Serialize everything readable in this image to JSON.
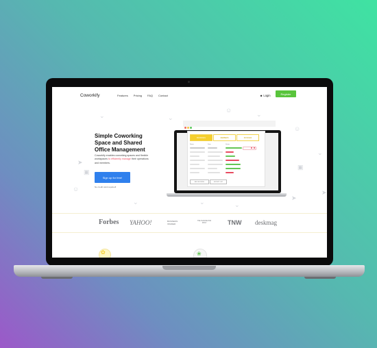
{
  "nav": {
    "logo": "Coworkify",
    "links": [
      "Features",
      "Pricing",
      "FAQ",
      "Contact"
    ],
    "login": "Login",
    "register": "Register"
  },
  "hero": {
    "title": "Simple Coworking Space and Shared Office Management",
    "desc_before": "Coworkify enables coworking spaces and flexible workspaces ",
    "desc_highlight": "to efficiently manage",
    "desc_after": " their operations and members.",
    "cta": "Sign up for free!",
    "note": "No credit card required!"
  },
  "app_preview": {
    "tabs": [
      "BOOKINGS",
      "MEMBERS",
      "INVOICES"
    ],
    "columns": [
      "Name",
      "Date",
      "Status"
    ],
    "buttons": [
      "ADD BOOKING",
      "EXPORT LIST"
    ]
  },
  "logos": [
    "Forbes",
    "YAHOO!",
    "BUSINESS INSIDER",
    "THE HUFFINGTON POST",
    "TNW",
    "deskmag"
  ],
  "colors": {
    "register": "#59c43c",
    "cta": "#2f80ed",
    "highlight": "#e84a5f",
    "tab_active": "#f5cf2e"
  }
}
